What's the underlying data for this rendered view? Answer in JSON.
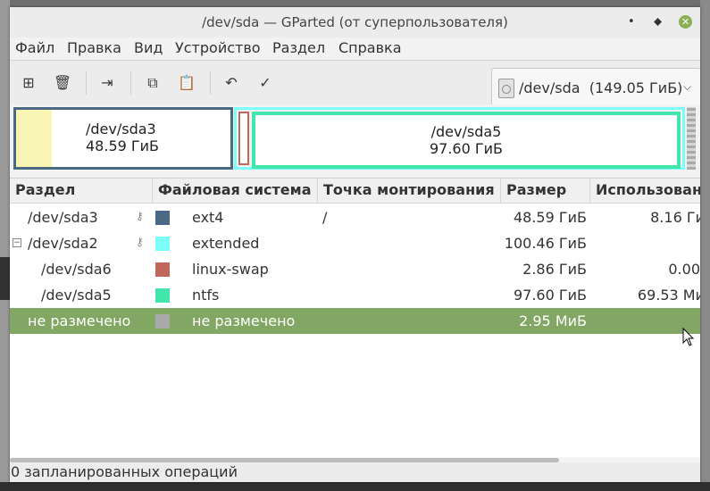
{
  "window": {
    "title": "/dev/sda — GParted (от суперпользователя)"
  },
  "menu": [
    "Файл",
    "Правка",
    "Вид",
    "Устройство",
    "Раздел",
    "Справка"
  ],
  "toolbar": {
    "buttons": [
      {
        "name": "new-partition",
        "icon": "new-icon",
        "glyph": "⊞"
      },
      {
        "name": "delete-partition",
        "icon": "trash-icon",
        "glyph": "🗑"
      },
      {
        "name": "resize-move",
        "icon": "resize-icon",
        "glyph": "⇥"
      },
      {
        "name": "copy",
        "icon": "copy-icon",
        "glyph": "⧉"
      },
      {
        "name": "paste",
        "icon": "paste-icon",
        "glyph": "📋"
      },
      {
        "name": "undo",
        "icon": "undo-icon",
        "glyph": "↶"
      },
      {
        "name": "apply",
        "icon": "check-icon",
        "glyph": "✓"
      }
    ],
    "device": "/dev/sda  (149.05 ГиБ)"
  },
  "graphic": {
    "sda3": {
      "name": "/dev/sda3",
      "size": "48.59 ГиБ",
      "used_fraction": 0.167
    },
    "sda5": {
      "name": "/dev/sda5",
      "size": "97.60 ГиБ"
    }
  },
  "table": {
    "headers": [
      "Раздел",
      "Файловая система",
      "Точка монтирования",
      "Размер",
      "Использован"
    ],
    "rows": [
      {
        "partition": "/dev/sda3",
        "fs": "ext4",
        "mount": "/",
        "size": "48.59 ГиБ",
        "used": "8.16 Ги",
        "color": "#4b6983",
        "key": true,
        "indent": false
      },
      {
        "partition": "/dev/sda2",
        "fs": "extended",
        "mount": "",
        "size": "100.46 ГиБ",
        "used": "-",
        "color": "#7dfff9",
        "key": true,
        "indent": false,
        "expander": "−"
      },
      {
        "partition": "/dev/sda6",
        "fs": "linux-swap",
        "mount": "",
        "size": "2.86 ГиБ",
        "used": "0.00",
        "color": "#c1665a",
        "key": false,
        "indent": true
      },
      {
        "partition": "/dev/sda5",
        "fs": "ntfs",
        "mount": "",
        "size": "97.60 ГиБ",
        "used": "69.53 Ми",
        "color": "#42e5ac",
        "key": false,
        "indent": true
      },
      {
        "partition": "не размечено",
        "fs": "не размечено",
        "mount": "",
        "size": "2.95 МиБ",
        "used": "-",
        "color": "#a9a9a9",
        "key": false,
        "indent": false,
        "selected": true
      }
    ]
  },
  "status": "0 запланированных операций"
}
